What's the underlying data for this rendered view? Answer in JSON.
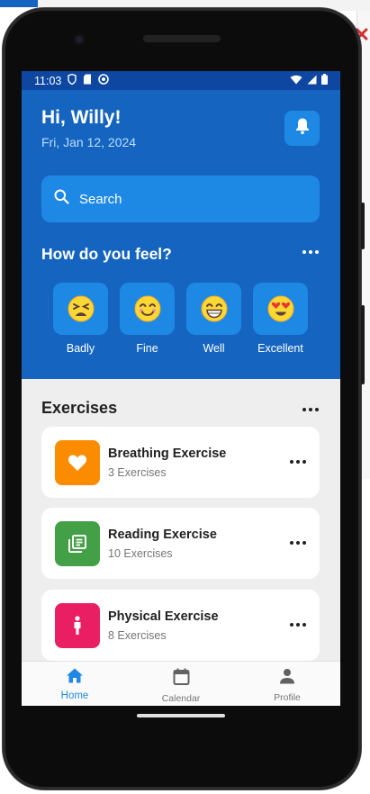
{
  "status": {
    "time": "11:03"
  },
  "header": {
    "greeting": "Hi, Willy!",
    "date": "Fri, Jan 12, 2024"
  },
  "search": {
    "placeholder": "Search"
  },
  "mood_section": {
    "title": "How do you feel?",
    "moods": [
      {
        "label": "Badly",
        "emoji": "😫"
      },
      {
        "label": "Fine",
        "emoji": "😊"
      },
      {
        "label": "Well",
        "emoji": "😁"
      },
      {
        "label": "Excellent",
        "emoji": "😍"
      }
    ]
  },
  "exercises_section": {
    "title": "Exercises",
    "items": [
      {
        "title": "Breathing Exercise",
        "subtitle": "3 Exercises",
        "icon": "heart-icon",
        "color": "#fb8c00"
      },
      {
        "title": "Reading Exercise",
        "subtitle": "10 Exercises",
        "icon": "book-icon",
        "color": "#43a047"
      },
      {
        "title": "Physical Exercise",
        "subtitle": "8 Exercises",
        "icon": "person-icon",
        "color": "#e91e63"
      }
    ]
  },
  "nav": {
    "items": [
      {
        "label": "Home",
        "icon": "home-icon",
        "active": true
      },
      {
        "label": "Calendar",
        "icon": "calendar-icon",
        "active": false
      },
      {
        "label": "Profile",
        "icon": "profile-icon",
        "active": false
      }
    ]
  },
  "colors": {
    "primary": "#1565c0",
    "primary_light": "#1e88e5",
    "accent": "#1e88e5"
  }
}
